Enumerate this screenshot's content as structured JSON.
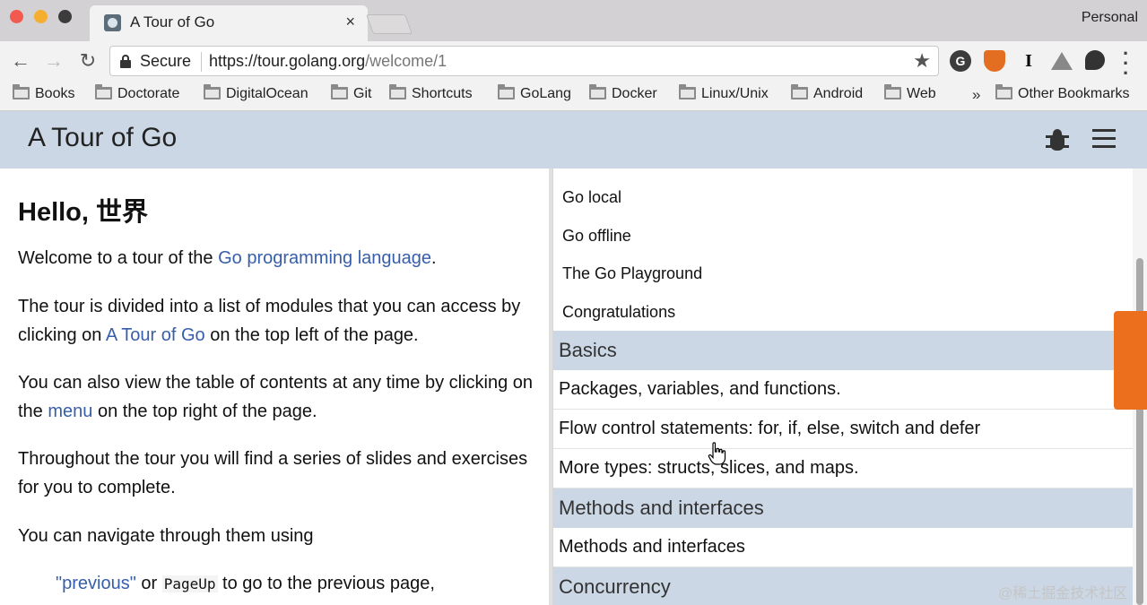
{
  "browser": {
    "tab_title": "A Tour of Go",
    "tab_close": "×",
    "profile": "Personal",
    "secure_label": "Secure",
    "url_host": "https://tour.golang.org",
    "url_path": "/welcome/1",
    "bookmarks": [
      "Books",
      "Doctorate",
      "DigitalOcean",
      "Git",
      "Shortcuts",
      "GoLang",
      "Docker",
      "Linux/Unix",
      "Android",
      "Web"
    ],
    "bookmarks_more": "»",
    "other_bookmarks": "Other Bookmarks"
  },
  "header": {
    "title": "A Tour of Go"
  },
  "article": {
    "heading": "Hello, 世界",
    "p1_before": "Welcome to a tour of the ",
    "p1_link": "Go programming language",
    "p1_after": ".",
    "p2_before": "The tour is divided into a list of modules that you can access by clicking on ",
    "p2_link": "A Tour of Go",
    "p2_after": " on the top left of the page.",
    "p3_before": "You can also view the table of contents at any time by clicking on the ",
    "p3_link": "menu",
    "p3_after": " on the top right of the page.",
    "p4": "Throughout the tour you will find a series of slides and exercises for you to complete.",
    "p5": "You can navigate through them using",
    "p6_link": "\"previous\"",
    "p6_or": " or ",
    "p6_key": "PageUp",
    "p6_after": " to go to the previous page,"
  },
  "toc": {
    "lessons": [
      "Go local",
      "Go offline",
      "The Go Playground",
      "Congratulations"
    ],
    "sections": [
      {
        "title": "Basics",
        "items": [
          "Packages, variables, and functions.",
          "Flow control statements: for, if, else, switch and defer",
          "More types: structs, slices, and maps."
        ]
      },
      {
        "title": "Methods and interfaces",
        "items": [
          "Methods and interfaces"
        ]
      },
      {
        "title": "Concurrency",
        "items": []
      }
    ]
  },
  "watermark": "@稀土掘金技术社区",
  "colors": {
    "header_bg": "#cbd7e5",
    "link": "#375eab",
    "accent_tab": "#eb6f1d"
  }
}
